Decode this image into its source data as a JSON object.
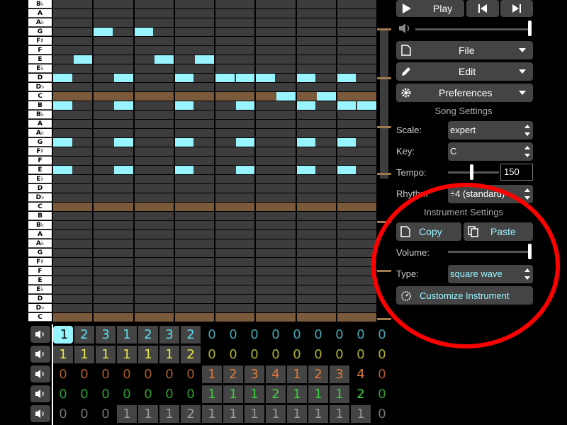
{
  "piano": {
    "keys": [
      "B♭",
      "A",
      "A♭",
      "G",
      "F♯",
      "F",
      "E",
      "E♭",
      "D",
      "D♭",
      "C",
      "B",
      "B♭",
      "A",
      "A♭",
      "G",
      "F♯",
      "F",
      "E",
      "E♭",
      "D",
      "D♭",
      "C",
      "B",
      "B♭",
      "A",
      "A♭",
      "G",
      "F♯",
      "F",
      "E",
      "E♭",
      "D",
      "D♭",
      "C"
    ],
    "tonic_rows": [
      10,
      22,
      34
    ]
  },
  "notes": [
    {
      "row": 3,
      "col": 2
    },
    {
      "row": 3,
      "col": 4
    },
    {
      "row": 6,
      "col": 1
    },
    {
      "row": 6,
      "col": 5
    },
    {
      "row": 6,
      "col": 7
    },
    {
      "row": 8,
      "col": 0
    },
    {
      "row": 8,
      "col": 3
    },
    {
      "row": 8,
      "col": 6
    },
    {
      "row": 8,
      "col": 8
    },
    {
      "row": 8,
      "col": 9
    },
    {
      "row": 8,
      "col": 10
    },
    {
      "row": 8,
      "col": 12
    },
    {
      "row": 8,
      "col": 14
    },
    {
      "row": 10,
      "col": 11
    },
    {
      "row": 10,
      "col": 13
    },
    {
      "row": 11,
      "col": 0
    },
    {
      "row": 11,
      "col": 3
    },
    {
      "row": 11,
      "col": 6
    },
    {
      "row": 11,
      "col": 9
    },
    {
      "row": 11,
      "col": 12
    },
    {
      "row": 11,
      "col": 14
    },
    {
      "row": 11,
      "col": 15
    },
    {
      "row": 15,
      "col": 0
    },
    {
      "row": 15,
      "col": 3
    },
    {
      "row": 15,
      "col": 6
    },
    {
      "row": 15,
      "col": 9
    },
    {
      "row": 15,
      "col": 12
    },
    {
      "row": 15,
      "col": 14
    },
    {
      "row": 18,
      "col": 0
    },
    {
      "row": 18,
      "col": 3
    },
    {
      "row": 18,
      "col": 6
    },
    {
      "row": 18,
      "col": 9
    },
    {
      "row": 18,
      "col": 12
    },
    {
      "row": 18,
      "col": 14
    }
  ],
  "transport": {
    "play_label": "Play"
  },
  "menus": {
    "file_label": "File",
    "edit_label": "Edit",
    "preferences_label": "Preferences"
  },
  "song_settings": {
    "header": "Song Settings",
    "scale_label": "Scale:",
    "scale_value": "expert",
    "key_label": "Key:",
    "key_value": "C",
    "tempo_label": "Tempo:",
    "tempo_value": "150",
    "rhythm_label": "Rhythm:",
    "rhythm_value": "÷4 (standard)"
  },
  "instrument_settings": {
    "header": "Instrument Settings",
    "copy_label": "Copy",
    "paste_label": "Paste",
    "volume_label": "Volume:",
    "type_label": "Type:",
    "type_value": "square wave",
    "customize_label": "Customize Instrument"
  },
  "tracks": [
    {
      "color": "#5fdcee",
      "selected": 0,
      "filled": 7,
      "patterns": [
        "1",
        "2",
        "3",
        "1",
        "2",
        "3",
        "2",
        "0",
        "0",
        "0",
        "0",
        "0",
        "0",
        "0",
        "0",
        "0"
      ]
    },
    {
      "color": "#e8e84a",
      "selected": -1,
      "filled": 7,
      "patterns": [
        "1",
        "1",
        "1",
        "1",
        "1",
        "1",
        "2",
        "0",
        "0",
        "0",
        "0",
        "0",
        "0",
        "0",
        "0",
        "0"
      ]
    },
    {
      "color": "#e07a3a",
      "selected": -1,
      "filled": 14,
      "start": 7,
      "patterns": [
        "0",
        "0",
        "0",
        "0",
        "0",
        "0",
        "0",
        "1",
        "2",
        "3",
        "4",
        "1",
        "2",
        "3",
        "4",
        "0"
      ]
    },
    {
      "color": "#3fcf3f",
      "selected": -1,
      "filled": 14,
      "start": 7,
      "patterns": [
        "0",
        "0",
        "0",
        "0",
        "0",
        "0",
        "0",
        "1",
        "1",
        "1",
        "2",
        "1",
        "1",
        "1",
        "2",
        "0"
      ]
    },
    {
      "color": "#9a9a9a",
      "selected": -1,
      "filled": 15,
      "start": 3,
      "patterns": [
        "0",
        "0",
        "0",
        "1",
        "1",
        "1",
        "2",
        "1",
        "1",
        "1",
        "1",
        "1",
        "1",
        "1",
        "1",
        "0"
      ]
    }
  ],
  "colors": {
    "note": "#98f4ff",
    "tonic": "#7a5a3a",
    "annotation": "#ff0000"
  }
}
